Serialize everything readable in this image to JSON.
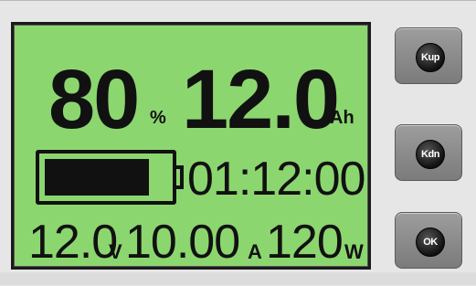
{
  "lcd": {
    "soc": {
      "value": "80",
      "unit": "%"
    },
    "capacity": {
      "value": "12.0",
      "unit": "Ah"
    },
    "battery_level": 0.85,
    "timer": "01:12:00",
    "voltage": {
      "value": "12.0",
      "unit": "V"
    },
    "current": {
      "value": "10.00",
      "unit": "A"
    },
    "power": {
      "value": "120",
      "unit": "W"
    }
  },
  "buttons": {
    "kup": "Kup",
    "kdn": "Kdn",
    "ok": "OK"
  },
  "colors": {
    "lcd_background": "#8cd66f",
    "segment": "#111111",
    "panel": "#e6e6e6"
  }
}
